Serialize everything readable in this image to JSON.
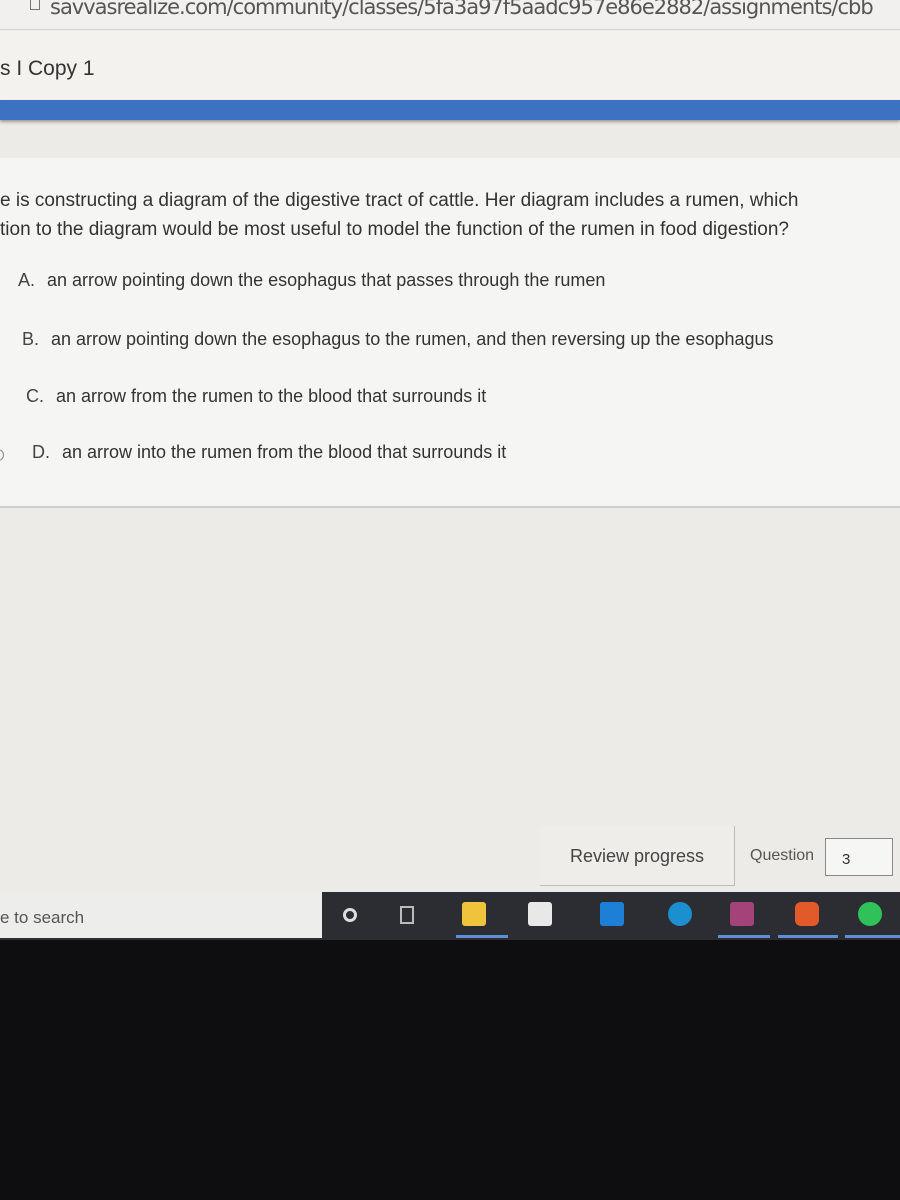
{
  "browser": {
    "url": "savvasrealize.com/community/classes/5fa3a97f5aadc957e86e2882/assignments/cbb"
  },
  "header": {
    "title": "s I Copy 1"
  },
  "question": {
    "text_line1": "e is constructing a diagram of the digestive tract of cattle. Her diagram includes a rumen, which",
    "text_line2": "tion to the diagram would be most useful to model the function of the rumen in food digestion?",
    "options": [
      {
        "letter": "A.",
        "text": "an arrow pointing down the esophagus that passes through the rumen"
      },
      {
        "letter": "B.",
        "text": "an arrow pointing down the esophagus to the rumen, and then reversing up the esophagus"
      },
      {
        "letter": "C.",
        "text": "an arrow from the rumen to the blood that surrounds it"
      },
      {
        "letter": "D.",
        "text": "an arrow into the rumen from the blood that surrounds it"
      }
    ]
  },
  "footer": {
    "review_label": "Review progress",
    "question_label": "Question",
    "question_number": "3"
  },
  "taskbar": {
    "search_placeholder": "e to search",
    "icons": [
      "cortana-icon",
      "task-view-icon",
      "file-explorer-icon",
      "store-icon",
      "mail-icon",
      "edge-icon",
      "winrar-icon",
      "brave-icon",
      "spotify-icon"
    ]
  },
  "colors": {
    "accent": "#3d72c2",
    "taskbar": "#2b2d33"
  }
}
